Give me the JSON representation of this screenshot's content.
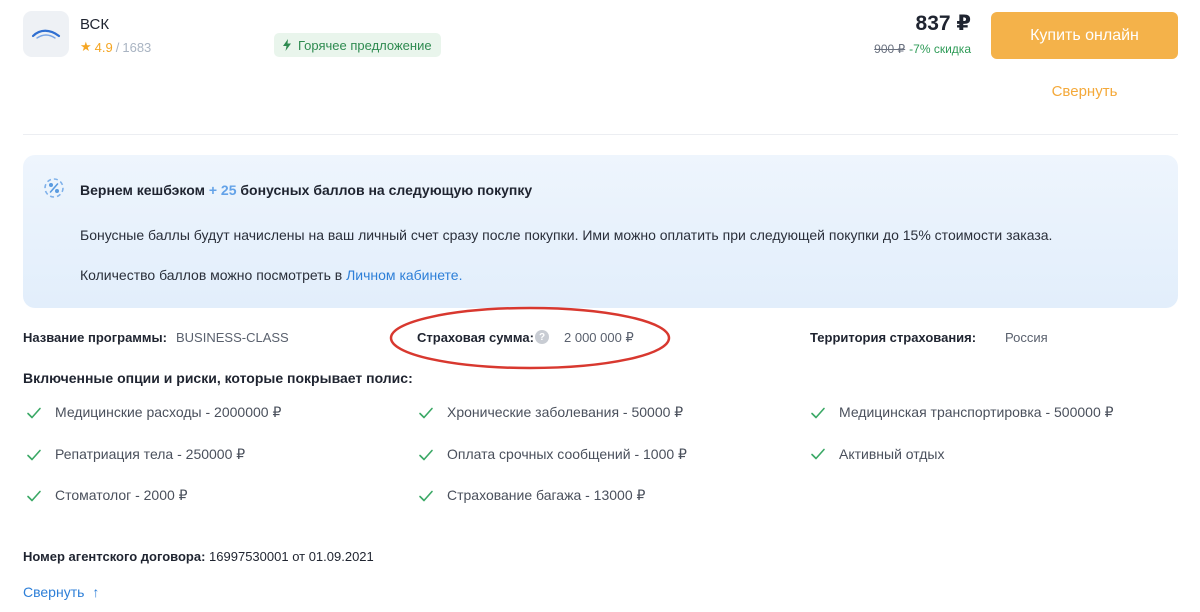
{
  "offer": {
    "company_name": "ВСК",
    "rating_value": "4.9",
    "rating_separator": "/",
    "reviews_count": "1683",
    "hot_badge": "Горячее предложение",
    "price": "837 ₽",
    "old_price": "900 ₽",
    "discount": "-7% скидка",
    "buy_label": "Купить онлайн",
    "collapse_label": "Свернуть",
    "colors": {
      "accent": "#f4b24a",
      "link": "#2d7fd8",
      "success": "#2e9b57"
    }
  },
  "cashback": {
    "title_prefix": "Вернем кешбэком",
    "title_bonus": "+ 25",
    "title_suffix": "бонусных баллов на следующую покупку",
    "text1": "Бонусные баллы будут начислены на ваш личный счет сразу после покупки. Ими можно оплатить при следующей покупки до 15% стоимости заказа.",
    "text2_prefix": "Количество баллов можно посмотреть в",
    "text2_link": "Личном кабинете."
  },
  "program": {
    "name_label": "Название программы:",
    "name_value": "BUSINESS-CLASS",
    "sum_label": "Страховая сумма:",
    "sum_value": "2 000 000 ₽",
    "help_icon": "?",
    "territory_label": "Территория страхования:",
    "territory_value": "Россия"
  },
  "options": {
    "title": "Включенные опции и риски, которые покрывает полис:",
    "items": [
      "Медицинские расходы - 2000000 ₽",
      "Хронические заболевания - 50000 ₽",
      "Медицинская транспортировка - 500000 ₽",
      "Репатриация тела - 250000 ₽",
      "Оплата срочных сообщений - 1000 ₽",
      "Активный отдых",
      "Стоматолог - 2000 ₽",
      "Страхование багажа - 13000 ₽"
    ]
  },
  "agent": {
    "label": "Номер агентского договора:",
    "value": "16997530001 от 01.09.2021"
  },
  "footer": {
    "collapse_label": "Свернуть",
    "arrow": "↑"
  }
}
